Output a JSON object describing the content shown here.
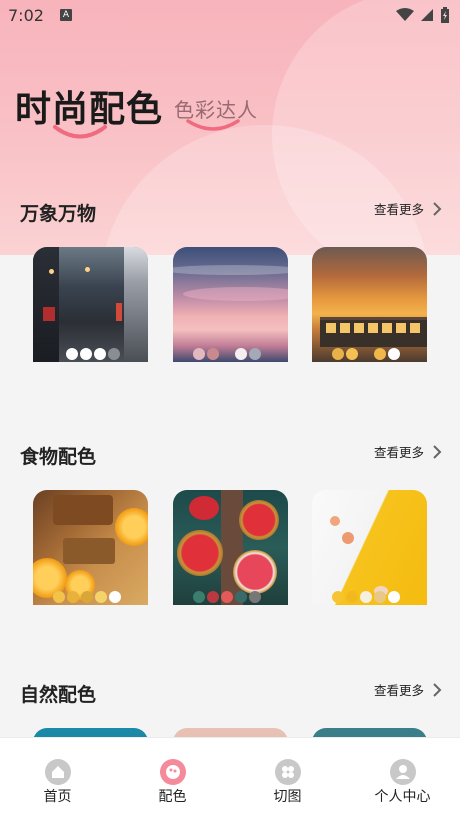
{
  "status_bar": {
    "time": "7:02",
    "badge": "A"
  },
  "header": {
    "title": "时尚配色",
    "subtitle": "色彩达人"
  },
  "sections": [
    {
      "title": "万象万物",
      "more": "查看更多"
    },
    {
      "title": "食物配色",
      "more": "查看更多"
    },
    {
      "title": "自然配色",
      "more": "查看更多"
    }
  ],
  "palettes": {
    "wanxiang": [
      [
        "#ffffff",
        "#ffffff",
        "#ffffff",
        "#8a8d92"
      ],
      [
        "#e3b8be",
        "#c98a8f",
        "#f5eef0",
        "#a5a8b8"
      ],
      [
        "#e8b24a",
        "#f3c153",
        "#f0b84a",
        "#ffffff"
      ]
    ],
    "food": [
      [
        "#f2c24a",
        "#e8b23a",
        "#d9a63a",
        "#f3d36a",
        "#ffffff"
      ],
      [
        "#3a7e6e",
        "#b83a40",
        "#e25a5a",
        "#3a6a6a",
        "#777777"
      ],
      [
        "#f5c430",
        "#f2b81f",
        "#f5f0e0",
        "#e9c886",
        "#ffffff"
      ]
    ]
  },
  "tabbar": [
    {
      "label": "首页",
      "icon": "home-icon"
    },
    {
      "label": "配色",
      "icon": "palette-icon",
      "active": true
    },
    {
      "label": "切图",
      "icon": "grid-icon"
    },
    {
      "label": "个人中心",
      "icon": "user-icon"
    }
  ],
  "colors": {
    "accent": "#f06a80",
    "header_pink": "#f8b3bb",
    "icon_gray": "#c8c8c8"
  }
}
